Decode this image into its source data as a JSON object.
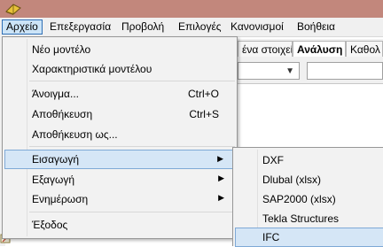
{
  "menubar": {
    "items": [
      {
        "label": "Αρχείο"
      },
      {
        "label": "Επεξεργασία"
      },
      {
        "label": "Προβολή"
      },
      {
        "label": "Επιλογές"
      },
      {
        "label": "Κανονισμοί"
      },
      {
        "label": "Βοήθεια"
      }
    ],
    "active_index": 0
  },
  "background": {
    "tabs": [
      {
        "label": "ένα στοιχεία"
      },
      {
        "label": "Ανάλυση"
      },
      {
        "label": "Καθολ"
      }
    ],
    "selected_tab": "Ανάλυση"
  },
  "file_menu": {
    "new_model": "Νέο μοντέλο",
    "model_properties": "Χαρακτηριστικά μοντέλου",
    "open": "Άνοιγμα...",
    "open_shortcut": "Ctrl+O",
    "save": "Αποθήκευση",
    "save_shortcut": "Ctrl+S",
    "save_as": "Αποθήκευση ως...",
    "import": "Εισαγωγή",
    "export": "Εξαγωγή",
    "update": "Ενημέρωση",
    "exit": "Έξοδος",
    "submenu_arrow": "▶"
  },
  "import_submenu": {
    "items": [
      {
        "label": "DXF"
      },
      {
        "label": "Dlubal (xlsx)"
      },
      {
        "label": "SAP2000 (xlsx)"
      },
      {
        "label": "Tekla Structures"
      },
      {
        "label": "IFC"
      }
    ],
    "highlighted": "IFC"
  },
  "colors": {
    "titlebar": "#c2877c",
    "menu_highlight": "#d5e6f6",
    "menu_highlight_border": "#7fa9d6",
    "active_menu": "#cce4f7"
  },
  "icons": {
    "app": "app-icon",
    "dropdown_arrow": "chevron-down-icon"
  }
}
